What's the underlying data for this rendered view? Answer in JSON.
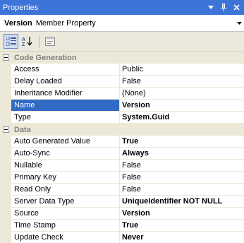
{
  "window": {
    "title": "Properties"
  },
  "object_selector": {
    "name": "Version",
    "type": "Member Property"
  },
  "categories": [
    {
      "name": "Code Generation",
      "rows": [
        {
          "name": "Access",
          "value": "Public",
          "bold": false
        },
        {
          "name": "Delay Loaded",
          "value": "False",
          "bold": false
        },
        {
          "name": "Inheritance Modifier",
          "value": "(None)",
          "bold": false
        },
        {
          "name": "Name",
          "value": "Version",
          "bold": true,
          "selected": true
        },
        {
          "name": "Type",
          "value": "System.Guid",
          "bold": true
        }
      ]
    },
    {
      "name": "Data",
      "rows": [
        {
          "name": "Auto Generated Value",
          "value": "True",
          "bold": true
        },
        {
          "name": "Auto-Sync",
          "value": "Always",
          "bold": true
        },
        {
          "name": "Nullable",
          "value": "False",
          "bold": false
        },
        {
          "name": "Primary Key",
          "value": "False",
          "bold": false
        },
        {
          "name": "Read Only",
          "value": "False",
          "bold": false
        },
        {
          "name": "Server Data Type",
          "value": "UniqueIdentifier NOT NULL",
          "bold": true
        },
        {
          "name": "Source",
          "value": "Version",
          "bold": true
        },
        {
          "name": "Time Stamp",
          "value": "True",
          "bold": true
        },
        {
          "name": "Update Check",
          "value": "Never",
          "bold": true
        }
      ]
    }
  ],
  "colors": {
    "titlebar": "#3d74d8",
    "selection": "#316ac5",
    "category_bg": "#ece9d8"
  }
}
